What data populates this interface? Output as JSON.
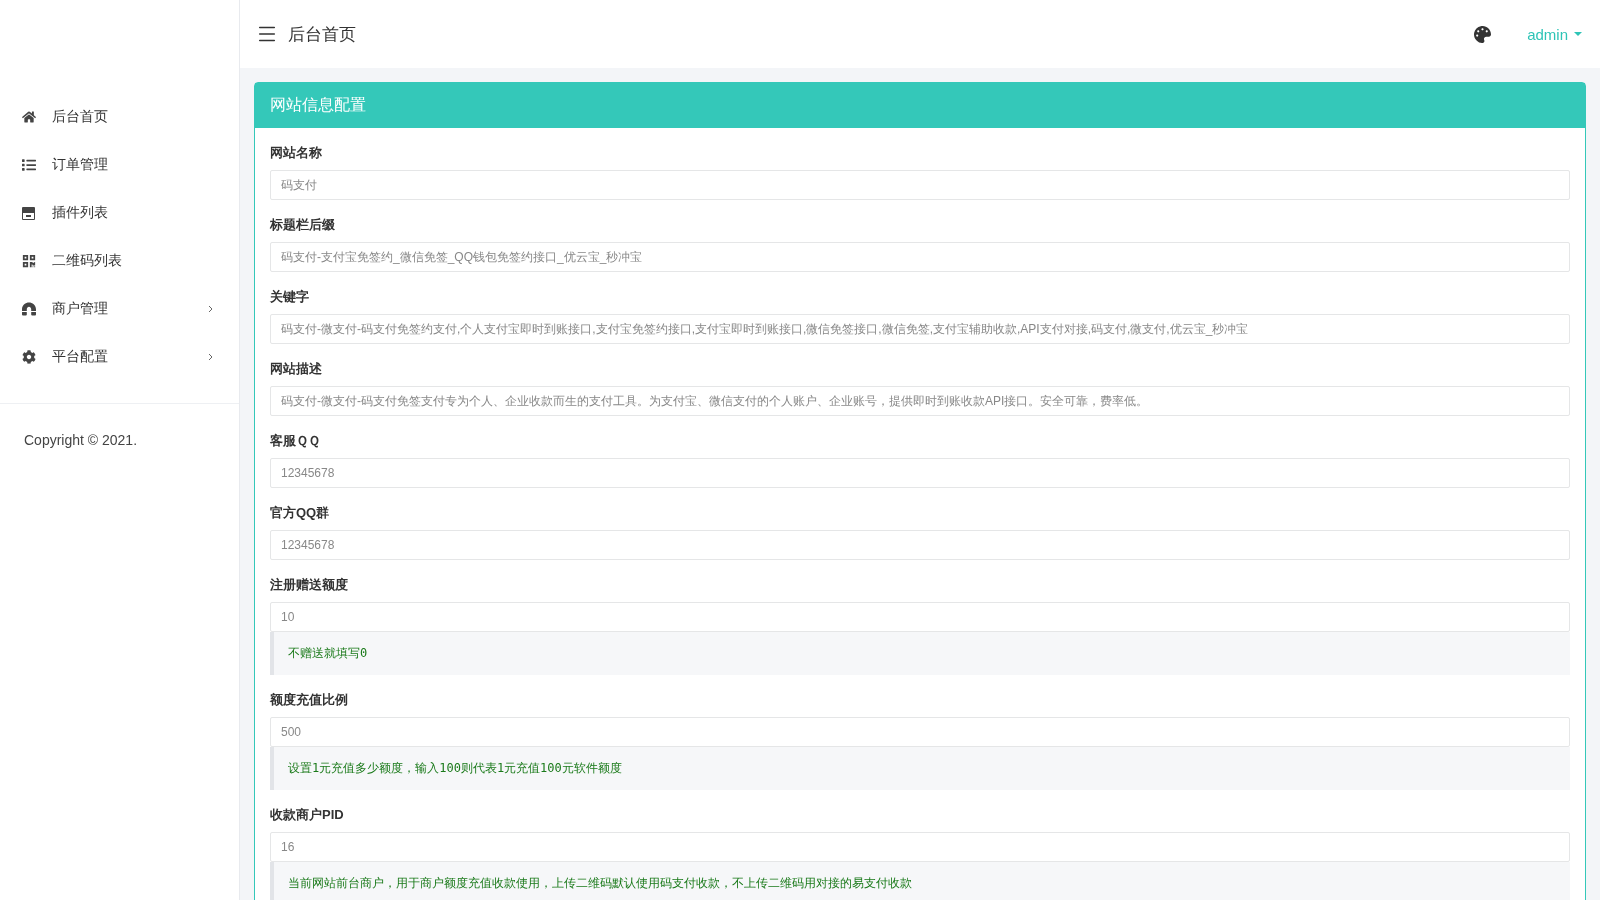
{
  "sidebar": {
    "items": [
      {
        "label": "后台首页",
        "kind": "home",
        "has_submenu": false
      },
      {
        "label": "订单管理",
        "kind": "list",
        "has_submenu": false
      },
      {
        "label": "插件列表",
        "kind": "box",
        "has_submenu": false
      },
      {
        "label": "二维码列表",
        "kind": "qrcode",
        "has_submenu": false
      },
      {
        "label": "商户管理",
        "kind": "magnet",
        "has_submenu": true
      },
      {
        "label": "平台配置",
        "kind": "gear",
        "has_submenu": true
      }
    ],
    "copyright": "Copyright © 2021."
  },
  "header": {
    "title": "后台首页",
    "user": "admin"
  },
  "panel": {
    "title": "网站信息配置",
    "fields": [
      {
        "label": "网站名称",
        "placeholder": "码支付"
      },
      {
        "label": "标题栏后缀",
        "placeholder": "码支付-支付宝免签约_微信免签_QQ钱包免签约接口_优云宝_秒冲宝"
      },
      {
        "label": "关键字",
        "placeholder": "码支付-微支付-码支付免签约支付,个人支付宝即时到账接口,支付宝免签约接口,支付宝即时到账接口,微信免签接口,微信免签,支付宝辅助收款,API支付对接,码支付,微支付,优云宝_秒冲宝"
      },
      {
        "label": "网站描述",
        "placeholder": "码支付-微支付-码支付免签支付专为个人、企业收款而生的支付工具。为支付宝、微信支付的个人账户、企业账号，提供即时到账收款API接口。安全可靠，费率低。"
      },
      {
        "label": "客服ＱＱ",
        "placeholder": "12345678"
      },
      {
        "label": "官方QQ群",
        "placeholder": "12345678"
      },
      {
        "label": "注册赠送额度",
        "placeholder": "10",
        "hint": "不赠送就填写0"
      },
      {
        "label": "额度充值比例",
        "placeholder": "500",
        "hint": "设置1元充值多少额度，输入100则代表1元充值100元软件额度"
      },
      {
        "label": "收款商户PID",
        "placeholder": "16",
        "hint": "当前网站前台商户，用于商户额度充值收款使用，上传二维码默认使用码支付收款，不上传二维码用对接的易支付收款"
      }
    ]
  }
}
